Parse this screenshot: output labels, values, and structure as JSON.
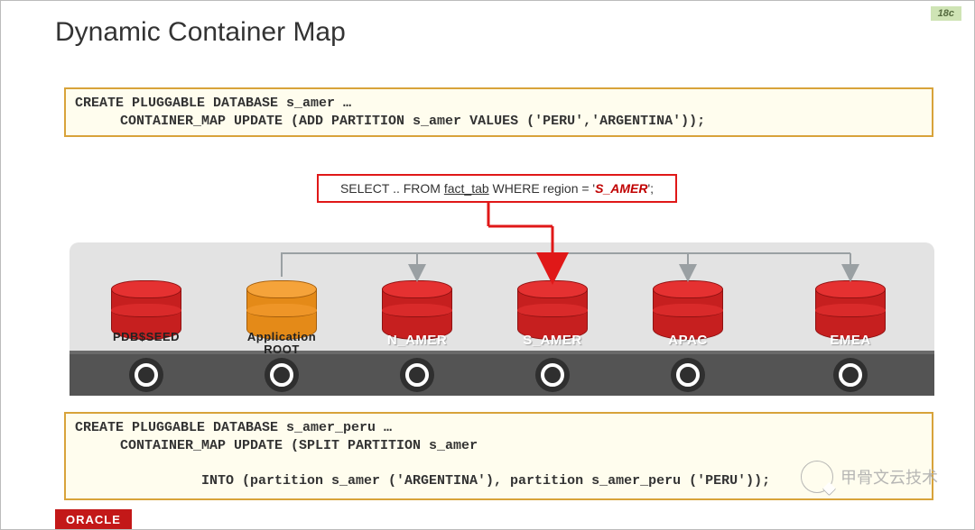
{
  "version_badge": "18c",
  "title": "Dynamic Container Map",
  "code_top_l1": "CREATE PLUGGABLE DATABASE s_amer …",
  "code_top_l2": "CONTAINER_MAP UPDATE (ADD PARTITION s_amer VALUES ('PERU','ARGENTINA'));",
  "select_prefix": "SELECT .. FROM ",
  "select_table": "fact_tab",
  "select_mid": "  WHERE region  = '",
  "select_value": "S_AMER",
  "select_suffix": "';",
  "dbs": {
    "seed": "PDB$SEED",
    "approot_l1": "Application",
    "approot_l2": "ROOT",
    "n_amer": "N_AMER",
    "s_amer": "S_AMER",
    "apac": "APAC",
    "emea": "EMEA"
  },
  "code_bot_l1": "CREATE PLUGGABLE DATABASE s_amer_peru …",
  "code_bot_l2": "CONTAINER_MAP UPDATE (SPLIT PARTITION s_amer",
  "code_bot_l3": "INTO (partition s_amer ('ARGENTINA'), partition s_amer_peru ('PERU'));",
  "footer_logo": "ORACLE",
  "watermark_text": "甲骨文云技术"
}
